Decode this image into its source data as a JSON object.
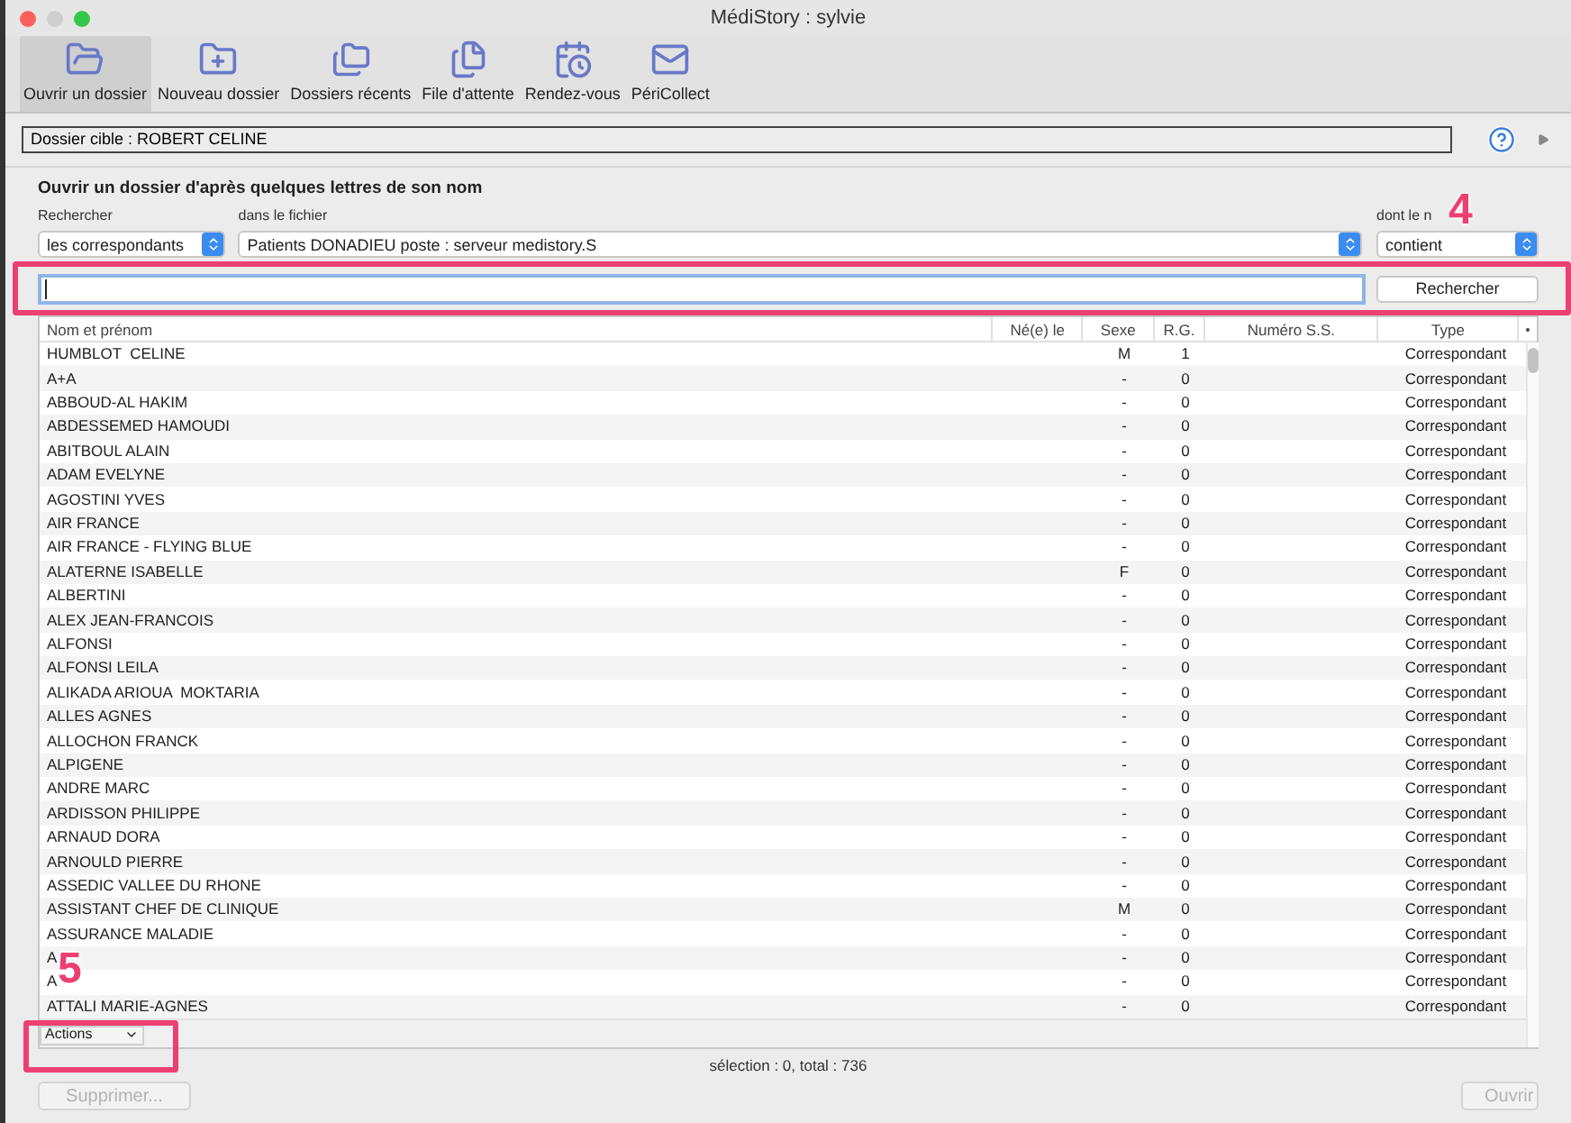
{
  "window": {
    "title": "MédiStory : sylvie"
  },
  "toolbar": [
    {
      "label": "Ouvrir un dossier",
      "selected": true
    },
    {
      "label": "Nouveau dossier",
      "selected": false
    },
    {
      "label": "Dossiers récents",
      "selected": false
    },
    {
      "label": "File d'attente",
      "selected": false
    },
    {
      "label": "Rendez-vous",
      "selected": false
    },
    {
      "label": "PériCollect",
      "selected": false
    }
  ],
  "target": "Dossier cible : ROBERT CELINE",
  "section_title": "Ouvrir un dossier d'après quelques lettres de son nom",
  "filters": [
    {
      "label": "Rechercher",
      "value": "les correspondants"
    },
    {
      "label": "dans le fichier",
      "value": "Patients DONADIEU poste : serveur medistory.S"
    },
    {
      "label": "dont le n",
      "value": "contient"
    }
  ],
  "search_button": "Rechercher",
  "table": {
    "columns": [
      "Nom et prénom",
      "Né(e) le",
      "Sexe",
      "R.G.",
      "Numéro S.S.",
      "Type"
    ],
    "rows": [
      {
        "name": "HUMBLOT  CELINE",
        "sex": "M",
        "rg": "1",
        "type": "Correspondant"
      },
      {
        "name": "A+A",
        "sex": "-",
        "rg": "0",
        "type": "Correspondant"
      },
      {
        "name": "ABBOUD-AL HAKIM",
        "sex": "-",
        "rg": "0",
        "type": "Correspondant"
      },
      {
        "name": "ABDESSEMED HAMOUDI",
        "sex": "-",
        "rg": "0",
        "type": "Correspondant"
      },
      {
        "name": "ABITBOUL ALAIN",
        "sex": "-",
        "rg": "0",
        "type": "Correspondant"
      },
      {
        "name": "ADAM EVELYNE",
        "sex": "-",
        "rg": "0",
        "type": "Correspondant"
      },
      {
        "name": "AGOSTINI YVES",
        "sex": "-",
        "rg": "0",
        "type": "Correspondant"
      },
      {
        "name": "AIR FRANCE",
        "sex": "-",
        "rg": "0",
        "type": "Correspondant"
      },
      {
        "name": "AIR FRANCE - FLYING BLUE",
        "sex": "-",
        "rg": "0",
        "type": "Correspondant"
      },
      {
        "name": "ALATERNE ISABELLE",
        "sex": "F",
        "rg": "0",
        "type": "Correspondant"
      },
      {
        "name": "ALBERTINI",
        "sex": "-",
        "rg": "0",
        "type": "Correspondant"
      },
      {
        "name": "ALEX JEAN-FRANCOIS",
        "sex": "-",
        "rg": "0",
        "type": "Correspondant"
      },
      {
        "name": "ALFONSI",
        "sex": "-",
        "rg": "0",
        "type": "Correspondant"
      },
      {
        "name": "ALFONSI LEILA",
        "sex": "-",
        "rg": "0",
        "type": "Correspondant"
      },
      {
        "name": "ALIKADA ARIOUA  MOKTARIA",
        "sex": "-",
        "rg": "0",
        "type": "Correspondant"
      },
      {
        "name": "ALLES AGNES",
        "sex": "-",
        "rg": "0",
        "type": "Correspondant"
      },
      {
        "name": "ALLOCHON FRANCK",
        "sex": "-",
        "rg": "0",
        "type": "Correspondant"
      },
      {
        "name": "ALPIGENE",
        "sex": "-",
        "rg": "0",
        "type": "Correspondant"
      },
      {
        "name": "ANDRE MARC",
        "sex": "-",
        "rg": "0",
        "type": "Correspondant"
      },
      {
        "name": "ARDISSON PHILIPPE",
        "sex": "-",
        "rg": "0",
        "type": "Correspondant"
      },
      {
        "name": "ARNAUD DORA",
        "sex": "-",
        "rg": "0",
        "type": "Correspondant"
      },
      {
        "name": "ARNOULD PIERRE",
        "sex": "-",
        "rg": "0",
        "type": "Correspondant"
      },
      {
        "name": "ASSEDIC VALLEE DU RHONE",
        "sex": "-",
        "rg": "0",
        "type": "Correspondant"
      },
      {
        "name": "ASSISTANT CHEF DE CLINIQUE",
        "sex": "M",
        "rg": "0",
        "type": "Correspondant"
      },
      {
        "name": "ASSURANCE MALADIE",
        "sex": "-",
        "rg": "0",
        "type": "Correspondant"
      },
      {
        "name": "A",
        "sex": "-",
        "rg": "0",
        "type": "Correspondant"
      },
      {
        "name": "A",
        "sex": "-",
        "rg": "0",
        "type": "Correspondant"
      },
      {
        "name": "ATTALI MARIE-AGNES",
        "sex": "-",
        "rg": "0",
        "type": "Correspondant"
      }
    ]
  },
  "actions_menu": "Actions",
  "status": "sélection : 0, total : 736",
  "buttons": [
    {
      "label": "Supprimer...",
      "disabled": true
    },
    {
      "label": "Ouvrir",
      "disabled": true
    }
  ],
  "callouts": [
    {
      "label": "4"
    },
    {
      "label": "5"
    }
  ]
}
